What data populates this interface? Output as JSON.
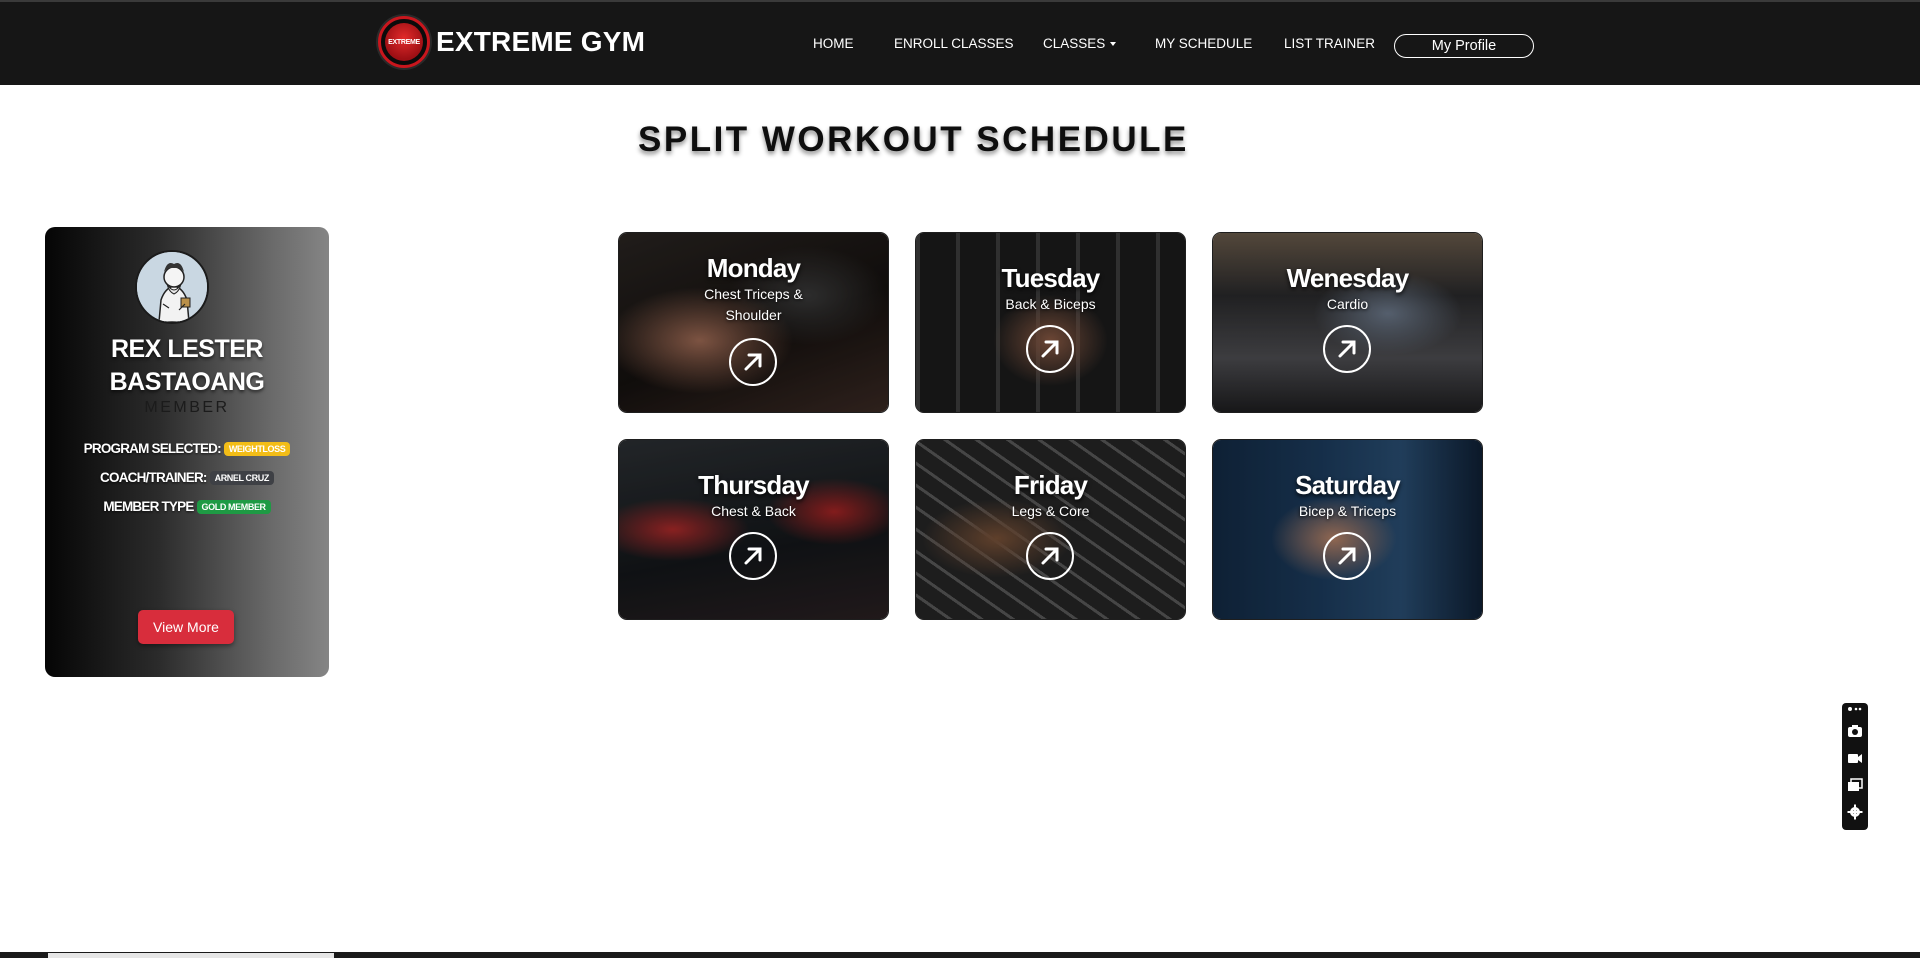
{
  "brand": {
    "name": "EXTREME GYM",
    "logo_text": "EXTREME"
  },
  "nav": {
    "items": [
      {
        "label": "HOME"
      },
      {
        "label": "ENROLL CLASSES"
      },
      {
        "label": "CLASSES"
      },
      {
        "label": "MY SCHEDULE"
      },
      {
        "label": "LIST TRAINER"
      }
    ],
    "profile_label": "My Profile"
  },
  "page": {
    "title": "SPLIT WORKOUT SCHEDULE"
  },
  "member": {
    "name": "REX LESTER BASTAOANG",
    "role": "MEMBER",
    "program_label": "PROGRAM SELECTED:",
    "program_value": "WEIGHTLOSS",
    "coach_label": "COACH/TRAINER:",
    "coach_value": "ARNEL CRUZ",
    "type_label": "MEMBER TYPE",
    "type_value": "GOLD MEMBER",
    "view_more_label": "View More"
  },
  "schedule": [
    {
      "day": "Monday",
      "focus": "Chest Triceps & Shoulder"
    },
    {
      "day": "Tuesday",
      "focus": "Back & Biceps"
    },
    {
      "day": "Wenesday",
      "focus": "Cardio"
    },
    {
      "day": "Thursday",
      "focus": "Chest & Back"
    },
    {
      "day": "Friday",
      "focus": "Legs & Core"
    },
    {
      "day": "Saturday",
      "focus": "Bicep & Triceps"
    }
  ],
  "icons": {
    "arrow": "arrow-up-right-icon",
    "tools": [
      "camera-icon",
      "video-icon",
      "windows-icon",
      "gear-icon"
    ]
  },
  "colors": {
    "navbar": "#161616",
    "accent_red": "#d82d3c",
    "badge_yellow": "#f3bd17",
    "badge_green": "#1e9a44",
    "badge_dark": "#3e4045"
  }
}
